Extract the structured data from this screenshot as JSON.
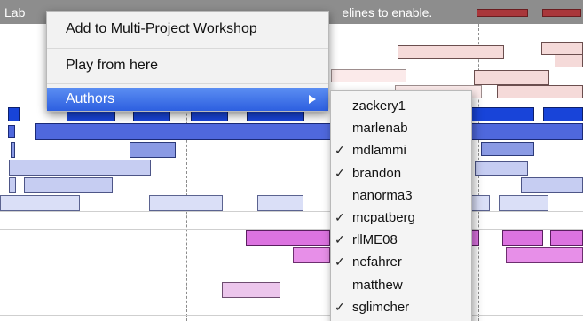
{
  "header": {
    "label_start": "Lab",
    "label_end": "elines to enable."
  },
  "context_menu": {
    "items": [
      {
        "label": "Add to Multi-Project Workshop"
      },
      {
        "label": "Play from here"
      },
      {
        "label": "Authors"
      }
    ]
  },
  "authors_submenu": {
    "items": [
      {
        "name": "zackery1",
        "checked": false
      },
      {
        "name": "marlenab",
        "checked": false
      },
      {
        "name": "mdlammi",
        "checked": true
      },
      {
        "name": "brandon",
        "checked": true
      },
      {
        "name": "nanorma3",
        "checked": false
      },
      {
        "name": "mcpatberg",
        "checked": true
      },
      {
        "name": "rllME08",
        "checked": true
      },
      {
        "name": "nefahrer",
        "checked": true
      },
      {
        "name": "matthew",
        "checked": false
      },
      {
        "name": "sglimcher",
        "checked": true
      }
    ],
    "check_glyph": "✓"
  },
  "colors": {
    "header_bg": "#8d8d8d",
    "highlight": "#3a6ee8",
    "accent_red": "#a9373b"
  }
}
